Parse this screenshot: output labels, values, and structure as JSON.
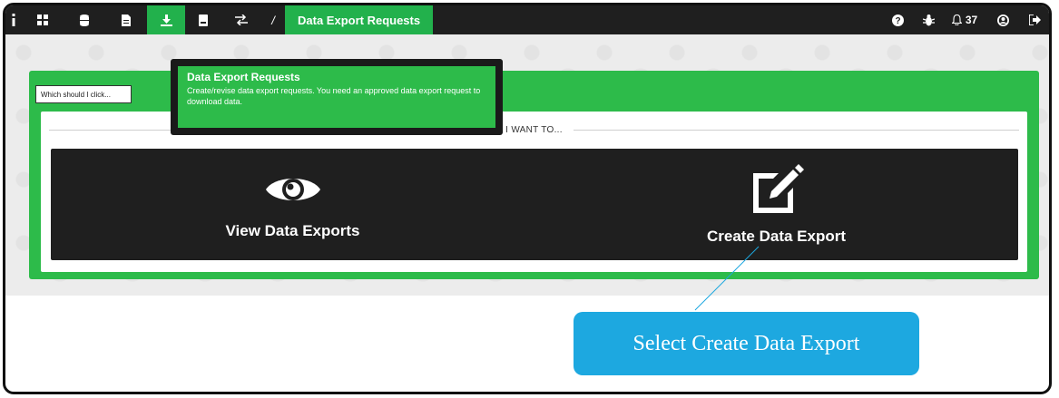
{
  "navbar": {
    "icons": [
      "info-icon",
      "dashboard-icon",
      "database-icon",
      "document-icon",
      "download-icon",
      "report-icon",
      "transfer-icon"
    ],
    "breadcrumb_separator": "/",
    "current_page": "Data Export Requests",
    "right_icons": [
      "help-icon",
      "bug-icon",
      "bell-icon",
      "user-icon",
      "logout-icon"
    ],
    "notification_count": "37"
  },
  "menu_tooltip": {
    "title": "Data Export Requests",
    "description": "Create/revise data export requests. You need an approved data export request to download data."
  },
  "hint": {
    "text": "Which should I click..."
  },
  "main": {
    "section_heading": "I WANT TO...",
    "choices": [
      {
        "label": "View Data Exports",
        "icon": "eye-icon"
      },
      {
        "label": "Create Data Export",
        "icon": "edit-icon"
      }
    ]
  },
  "callout": {
    "text": "Select Create Data Export"
  },
  "colors": {
    "accent_green": "#2dbb4a",
    "nav_dark": "#1f1f1f",
    "callout_blue": "#1da8e0"
  }
}
